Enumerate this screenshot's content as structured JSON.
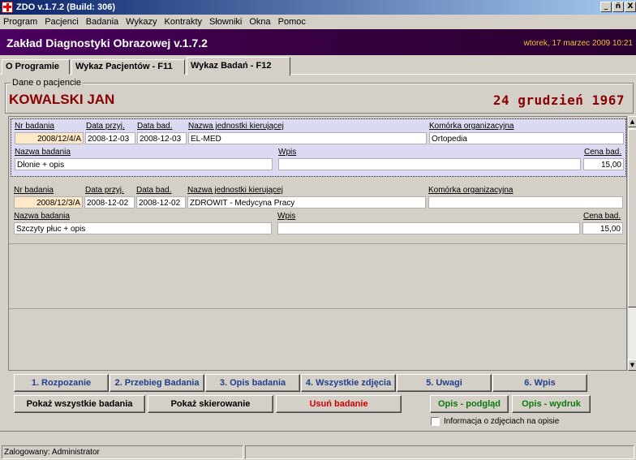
{
  "window": {
    "title": "ZDO v.1.7.2 (Build: 306)",
    "controls": [
      "_",
      "ñ",
      "X"
    ]
  },
  "menu": [
    "Program",
    "Pacjenci",
    "Badania",
    "Wykazy",
    "Kontrakty",
    "Słowniki",
    "Okna",
    "Pomoc"
  ],
  "banner": {
    "title": "Zakład Diagnostyki Obrazowej v.1.7.2",
    "date": "wtorek, 17 marzec 2009 10:21"
  },
  "tabs": [
    "O Programie",
    "Wykaz Pacjentów - F11",
    "Wykaz Badań - F12"
  ],
  "patient": {
    "caption": "Dane o pacjencie",
    "name": "KOWALSKI JAN",
    "dob": "24 grudzień 1967"
  },
  "exam_labels": {
    "nr": "Nr badania",
    "data_przyj": "Data przyj.",
    "data_bad": "Data bad.",
    "jednostka": "Nazwa jednostki kierującej",
    "komorka": "Komórka organizacyjna",
    "nazwa": "Nazwa badania",
    "wpis": "Wpis",
    "cena": "Cena bad."
  },
  "exams": [
    {
      "nr": "2008/12/4/A",
      "data_przyj": "2008-12-03",
      "data_bad": "2008-12-03",
      "jednostka": "EL-MED",
      "komorka": "Ortopedia",
      "nazwa": "Dłonie + opis",
      "wpis": "",
      "cena": "15,00"
    },
    {
      "nr": "2008/12/3/A",
      "data_przyj": "2008-12-02",
      "data_bad": "2008-12-02",
      "jednostka": "ZDROWIT - Medycyna Pracy",
      "komorka": "",
      "nazwa": "Szczyty płuc + opis",
      "wpis": "",
      "cena": "15,00"
    }
  ],
  "section_buttons": [
    "1. Rozpozanie",
    "2. Przebieg Badania",
    "3. Opis badania",
    "4. Wszystkie zdjęcia",
    "5. Uwagi",
    "6. Wpis"
  ],
  "action_buttons": {
    "show_all": "Pokaż wszystkie badania",
    "show_referral": "Pokaż skierowanie",
    "delete": "Usuń badanie",
    "preview": "Opis - podgląd",
    "print": "Opis - wydruk"
  },
  "checkbox_label": "Informacja o zdjęciach na opisie",
  "status": {
    "user": "Zalogowany: Administrator"
  }
}
